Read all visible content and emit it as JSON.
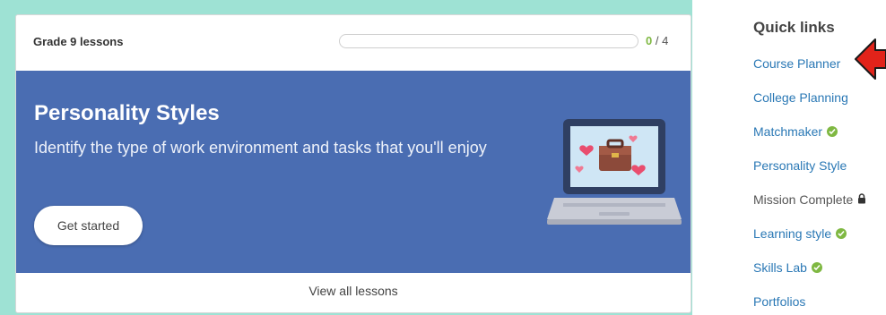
{
  "lessons_card": {
    "title": "Grade 9 lessons",
    "progress": {
      "completed": "0",
      "separator": "/",
      "total": "4",
      "fraction": 0
    },
    "hero": {
      "title": "Personality Styles",
      "description": "Identify the type of work environment and tasks that you'll enjoy",
      "button_label": "Get started",
      "background_color": "#4a6db2",
      "illustration": "laptop-briefcase-hearts-icon"
    },
    "footer_link": "View all lessons"
  },
  "quick_links": {
    "title": "Quick links",
    "items": [
      {
        "label": "Course Planner",
        "status": "link"
      },
      {
        "label": "College Planning",
        "status": "link"
      },
      {
        "label": "Matchmaker",
        "status": "done"
      },
      {
        "label": "Personality Style",
        "status": "link"
      },
      {
        "label": "Mission Complete",
        "status": "locked"
      },
      {
        "label": "Learning style",
        "status": "done"
      },
      {
        "label": "Skills Lab",
        "status": "done"
      },
      {
        "label": "Portfolios",
        "status": "link"
      }
    ]
  },
  "colors": {
    "frame": "#9ee2d4",
    "accent_green": "#7fb842",
    "link_blue": "#2a78b5",
    "annotation_arrow": "#e2231a"
  },
  "icons": {
    "check": "check-circle-icon",
    "lock": "lock-icon",
    "annotation": "red-arrow-left-icon"
  }
}
